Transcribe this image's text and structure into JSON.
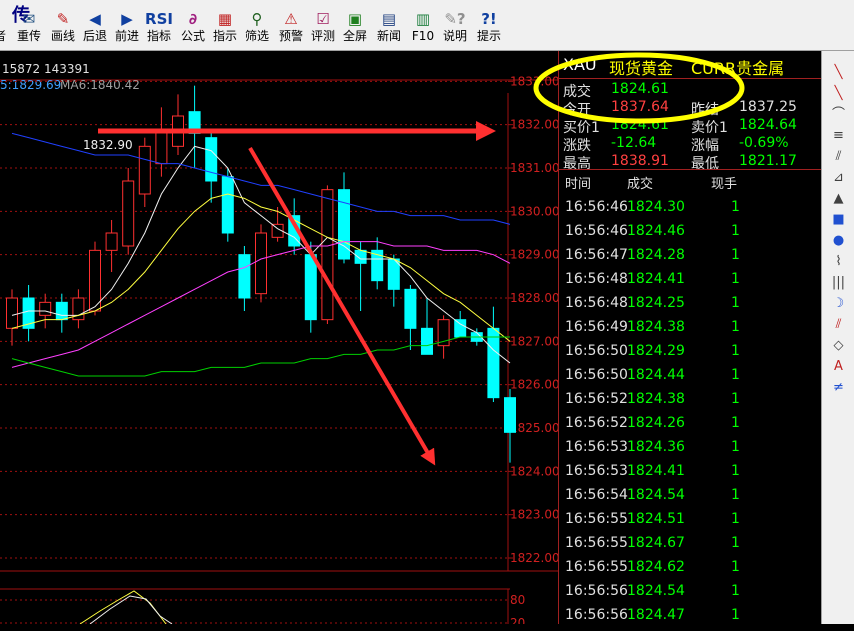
{
  "colors": {
    "up": "#ff3030",
    "down": "#00ffff",
    "price_up": "#ff4040",
    "price_down": "#00ff00",
    "grid": "#a01010",
    "annotation": "#ffff00",
    "arrow": "#ff3030"
  },
  "title_strip": "",
  "toolbar": [
    {
      "label": "传",
      "icon": "传",
      "name": "chuan",
      "color": "#000080",
      "bigtext": true
    },
    {
      "label": "重传",
      "icon": "✉",
      "name": "resend",
      "color": "#205080"
    },
    {
      "label": "画线",
      "icon": "✎",
      "name": "draw-line",
      "color": "#c02020"
    },
    {
      "label": "后退",
      "icon": "◀",
      "name": "back",
      "color": "#1040a0"
    },
    {
      "label": "前进",
      "icon": "▶",
      "name": "forward",
      "color": "#1040a0"
    },
    {
      "label": "指标",
      "icon": "RSI",
      "name": "indicator",
      "color": "#1040a0"
    },
    {
      "label": "公式",
      "icon": "∂",
      "name": "formula",
      "color": "#a02080"
    },
    {
      "label": "指示",
      "icon": "▦",
      "name": "indicate",
      "color": "#c02020"
    },
    {
      "label": "筛选",
      "icon": "⚲",
      "name": "filter",
      "color": "#206020"
    },
    {
      "label": "预警",
      "icon": "⚠",
      "name": "alert",
      "color": "#c02020"
    },
    {
      "label": "评测",
      "icon": "☑",
      "name": "evaluate",
      "color": "#a02060"
    },
    {
      "label": "全屏",
      "icon": "▣",
      "name": "fullscreen",
      "color": "#208020"
    },
    {
      "label": "新闻",
      "icon": "▤",
      "name": "news",
      "color": "#204080"
    },
    {
      "label": "F10",
      "icon": "▥",
      "name": "f10",
      "color": "#208040"
    },
    {
      "label": "说明",
      "icon": "✎?",
      "name": "explain",
      "color": "#909090"
    },
    {
      "label": "提示",
      "icon": "?!",
      "name": "hint",
      "color": "#1040a0"
    }
  ],
  "chart_header": {
    "vol_text": "15872 143391",
    "ma5": "5:1829.69",
    "ma6": "MA6:1840.42"
  },
  "chart_data": {
    "type": "candlestick",
    "y_axis_ticks": [
      "1833.00",
      "1832.00",
      "1831.00",
      "1830.00",
      "1829.00",
      "1828.00",
      "1827.00",
      "1826.00",
      "1825.00",
      "1824.00",
      "1823.00",
      "1822.00"
    ],
    "ylim": [
      1821.7,
      1833.4
    ],
    "high_annotation": "1832.90",
    "candles": [
      {
        "o": 1827.3,
        "h": 1828.2,
        "l": 1826.9,
        "c": 1828.0
      },
      {
        "o": 1828.0,
        "h": 1828.3,
        "l": 1827.0,
        "c": 1827.3
      },
      {
        "o": 1827.6,
        "h": 1828.1,
        "l": 1827.3,
        "c": 1827.9
      },
      {
        "o": 1827.9,
        "h": 1828.1,
        "l": 1827.2,
        "c": 1827.5
      },
      {
        "o": 1827.5,
        "h": 1828.2,
        "l": 1827.3,
        "c": 1828.0
      },
      {
        "o": 1827.7,
        "h": 1829.3,
        "l": 1827.6,
        "c": 1829.1
      },
      {
        "o": 1829.1,
        "h": 1829.8,
        "l": 1828.6,
        "c": 1829.5
      },
      {
        "o": 1829.2,
        "h": 1831.0,
        "l": 1829.0,
        "c": 1830.7
      },
      {
        "o": 1830.4,
        "h": 1831.7,
        "l": 1830.1,
        "c": 1831.5
      },
      {
        "o": 1831.1,
        "h": 1832.4,
        "l": 1830.8,
        "c": 1831.9
      },
      {
        "o": 1831.5,
        "h": 1832.7,
        "l": 1831.3,
        "c": 1832.2
      },
      {
        "o": 1832.3,
        "h": 1832.9,
        "l": 1831.0,
        "c": 1831.8
      },
      {
        "o": 1831.7,
        "h": 1831.8,
        "l": 1830.2,
        "c": 1830.7
      },
      {
        "o": 1830.8,
        "h": 1831.0,
        "l": 1829.3,
        "c": 1829.5
      },
      {
        "o": 1829.0,
        "h": 1829.2,
        "l": 1827.7,
        "c": 1828.0
      },
      {
        "o": 1828.1,
        "h": 1829.7,
        "l": 1827.9,
        "c": 1829.5
      },
      {
        "o": 1829.4,
        "h": 1830.1,
        "l": 1829.3,
        "c": 1829.7
      },
      {
        "o": 1829.9,
        "h": 1830.3,
        "l": 1829.0,
        "c": 1829.2
      },
      {
        "o": 1829.0,
        "h": 1829.3,
        "l": 1827.2,
        "c": 1827.5
      },
      {
        "o": 1827.5,
        "h": 1830.6,
        "l": 1827.4,
        "c": 1830.5
      },
      {
        "o": 1830.5,
        "h": 1830.9,
        "l": 1828.8,
        "c": 1828.9
      },
      {
        "o": 1829.1,
        "h": 1829.3,
        "l": 1827.7,
        "c": 1828.8
      },
      {
        "o": 1829.1,
        "h": 1829.4,
        "l": 1828.2,
        "c": 1828.4
      },
      {
        "o": 1828.9,
        "h": 1829.0,
        "l": 1827.8,
        "c": 1828.2
      },
      {
        "o": 1828.2,
        "h": 1828.3,
        "l": 1826.8,
        "c": 1827.3
      },
      {
        "o": 1827.3,
        "h": 1828.0,
        "l": 1826.9,
        "c": 1826.7
      },
      {
        "o": 1826.9,
        "h": 1827.6,
        "l": 1826.6,
        "c": 1827.5
      },
      {
        "o": 1827.5,
        "h": 1827.7,
        "l": 1827.1,
        "c": 1827.1
      },
      {
        "o": 1827.2,
        "h": 1827.3,
        "l": 1826.9,
        "c": 1827.0
      },
      {
        "o": 1827.3,
        "h": 1827.8,
        "l": 1825.6,
        "c": 1825.7
      },
      {
        "o": 1825.7,
        "h": 1825.9,
        "l": 1824.2,
        "c": 1824.9
      }
    ],
    "series": [
      {
        "name": "",
        "color": "#f0f0f0",
        "values": [
          1827.6,
          1827.7,
          1827.7,
          1827.6,
          1827.6,
          1827.8,
          1828.2,
          1828.8,
          1829.5,
          1830.4,
          1831.0,
          1831.5,
          1831.4,
          1831.0,
          1830.2,
          1829.9,
          1829.6,
          1829.4,
          1829.0,
          1829.4,
          1829.2,
          1828.9,
          1828.9,
          1828.9,
          1828.5,
          1828.0,
          1827.7,
          1827.4,
          1827.2,
          1826.8,
          1826.5
        ]
      },
      {
        "name": "",
        "color": "#ffff40",
        "values": [
          1827.3,
          1827.4,
          1827.5,
          1827.5,
          1827.6,
          1827.7,
          1827.9,
          1828.2,
          1828.6,
          1829.1,
          1829.6,
          1830.0,
          1830.3,
          1830.4,
          1830.3,
          1830.1,
          1830.0,
          1829.8,
          1829.6,
          1829.4,
          1829.3,
          1829.1,
          1829.0,
          1828.9,
          1828.7,
          1828.4,
          1828.1,
          1827.9,
          1827.6,
          1827.3,
          1827.0
        ]
      },
      {
        "name": "",
        "color": "#ff40ff",
        "values": [
          1826.4,
          1826.5,
          1826.6,
          1826.7,
          1826.8,
          1827.0,
          1827.2,
          1827.4,
          1827.6,
          1827.8,
          1828.0,
          1828.2,
          1828.4,
          1828.6,
          1828.7,
          1828.9,
          1829.0,
          1829.1,
          1829.2,
          1829.2,
          1829.3,
          1829.3,
          1829.3,
          1829.2,
          1829.2,
          1829.2,
          1829.1,
          1829.1,
          1829.1,
          1829.0,
          1828.8
        ]
      },
      {
        "name": "",
        "color": "#00d000",
        "values": [
          1826.6,
          1826.5,
          1826.4,
          1826.3,
          1826.2,
          1826.2,
          1826.2,
          1826.2,
          1826.2,
          1826.3,
          1826.3,
          1826.3,
          1826.4,
          1826.4,
          1826.4,
          1826.5,
          1826.5,
          1826.5,
          1826.6,
          1826.6,
          1826.7,
          1826.7,
          1826.8,
          1826.8,
          1826.9,
          1826.9,
          1827.0,
          1827.1,
          1827.1,
          1827.1,
          1827.1
        ]
      },
      {
        "name": "",
        "color": "#2040ff",
        "values": [
          1831.8,
          1831.7,
          1831.6,
          1831.5,
          1831.4,
          1831.3,
          1831.3,
          1831.3,
          1831.2,
          1831.1,
          1831.1,
          1831.0,
          1830.9,
          1830.8,
          1830.7,
          1830.6,
          1830.6,
          1830.5,
          1830.4,
          1830.3,
          1830.2,
          1830.1,
          1830.0,
          1830.0,
          1829.9,
          1829.9,
          1829.9,
          1829.8,
          1829.8,
          1829.8,
          1829.7
        ]
      }
    ],
    "sub_axis_ticks": [
      "80",
      "20"
    ]
  },
  "quote": {
    "symbol": "XAU",
    "name": "现货黄金",
    "category": "CURR贵金属",
    "rows": [
      {
        "l1": "成交",
        "v1": "1824.61",
        "c1": "#00ff00",
        "l2": "",
        "v2": "",
        "c2": ""
      },
      {
        "l1": "今开",
        "v1": "1837.64",
        "c1": "#ff4040",
        "l2": "昨结",
        "v2": "1837.25",
        "c2": "#e0e0e0"
      },
      {
        "l1": "买价1",
        "v1": "1824.61",
        "c1": "#00ff00",
        "l2": "卖价1",
        "v2": "1824.64",
        "c2": "#00ff00"
      },
      {
        "l1": "涨跌",
        "v1": "-12.64",
        "c1": "#00ff00",
        "l2": "涨幅",
        "v2": "-0.69%",
        "c2": "#00ff00"
      },
      {
        "l1": "最高",
        "v1": "1838.91",
        "c1": "#ff4040",
        "l2": "最低",
        "v2": "1821.17",
        "c2": "#00ff00"
      }
    ],
    "columns": [
      "时间",
      "成交",
      "现手"
    ],
    "ticks": [
      [
        "16:56:46",
        "1824.30",
        "1"
      ],
      [
        "16:56:46",
        "1824.46",
        "1"
      ],
      [
        "16:56:47",
        "1824.28",
        "1"
      ],
      [
        "16:56:48",
        "1824.41",
        "1"
      ],
      [
        "16:56:48",
        "1824.25",
        "1"
      ],
      [
        "16:56:49",
        "1824.38",
        "1"
      ],
      [
        "16:56:50",
        "1824.29",
        "1"
      ],
      [
        "16:56:50",
        "1824.44",
        "1"
      ],
      [
        "16:56:52",
        "1824.38",
        "1"
      ],
      [
        "16:56:52",
        "1824.26",
        "1"
      ],
      [
        "16:56:53",
        "1824.36",
        "1"
      ],
      [
        "16:56:53",
        "1824.41",
        "1"
      ],
      [
        "16:56:54",
        "1824.54",
        "1"
      ],
      [
        "16:56:55",
        "1824.51",
        "1"
      ],
      [
        "16:56:55",
        "1824.67",
        "1"
      ],
      [
        "16:56:55",
        "1824.62",
        "1"
      ],
      [
        "16:56:56",
        "1824.54",
        "1"
      ],
      [
        "16:56:56",
        "1824.47",
        "1"
      ]
    ]
  },
  "sidebar_tools": [
    {
      "icon": "╲",
      "name": "line-tool-icon",
      "color": "#c02020"
    },
    {
      "icon": "╲",
      "name": "ray-tool-icon",
      "color": "#c02020"
    },
    {
      "icon": "⌒",
      "name": "arc-tool-icon",
      "color": "#404040"
    },
    {
      "icon": "≡",
      "name": "channel-tool-icon",
      "color": "#404040"
    },
    {
      "icon": "⫽",
      "name": "parallel-tool-icon",
      "color": "#404040"
    },
    {
      "icon": "⊿",
      "name": "fan-tool-icon",
      "color": "#404040"
    },
    {
      "icon": "▲",
      "name": "triangle-tool-icon",
      "color": "#404040"
    },
    {
      "icon": "■",
      "name": "rect-tool-icon",
      "color": "#2050d0"
    },
    {
      "icon": "●",
      "name": "ellipse-tool-icon",
      "color": "#2050d0"
    },
    {
      "icon": "⌇",
      "name": "cycle-tool-icon",
      "color": "#404040"
    },
    {
      "icon": "|||",
      "name": "period-tool-icon",
      "color": "#404040"
    },
    {
      "icon": "☽",
      "name": "arc2-tool-icon",
      "color": "#2050d0"
    },
    {
      "icon": "⫽",
      "name": "gann-tool-icon",
      "color": "#c02020"
    },
    {
      "icon": "◇",
      "name": "eraser-tool-icon",
      "color": "#404040"
    },
    {
      "icon": "A",
      "name": "text-tool-icon",
      "color": "#c02020"
    },
    {
      "icon": "≠",
      "name": "fib-tool-icon",
      "color": "#2050d0"
    }
  ]
}
